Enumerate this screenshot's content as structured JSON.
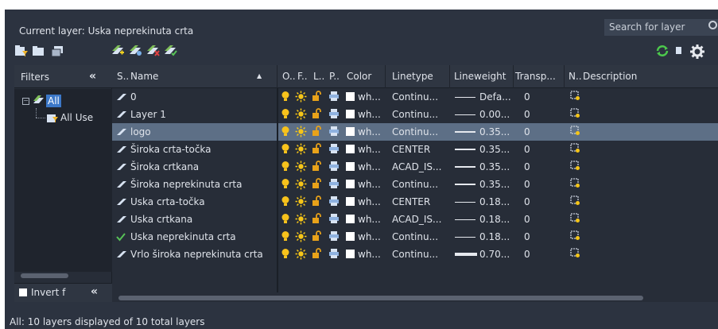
{
  "header": {
    "current_layer": "Current layer: Uska neprekinuta crta",
    "search_placeholder": "Search for layer"
  },
  "filters": {
    "title": "Filters",
    "tree": [
      {
        "label": "All",
        "selected": true
      },
      {
        "label": "All Use"
      }
    ],
    "invert_label": "Invert f"
  },
  "columns": [
    "S..",
    "Name",
    "O..",
    "F..",
    "L..",
    "P..",
    "Color",
    "Linetype",
    "Lineweight",
    "Transp...",
    "N..",
    "Description"
  ],
  "layers": [
    {
      "status": "layer",
      "name": "0",
      "color": "wh...",
      "linetype": "Continu...",
      "lineweight": "Defa...",
      "lw_style": "thin",
      "transparency": "0",
      "selected": false
    },
    {
      "status": "layer",
      "name": "Layer 1",
      "color": "wh...",
      "linetype": "Continu...",
      "lineweight": "0.00...",
      "lw_style": "thin",
      "transparency": "0",
      "selected": false
    },
    {
      "status": "layer",
      "name": "logo",
      "color": "wh...",
      "linetype": "Continu...",
      "lineweight": "0.35...",
      "lw_style": "medium",
      "transparency": "0",
      "selected": true
    },
    {
      "status": "layer",
      "name": "Široka crta-točka",
      "color": "wh...",
      "linetype": "CENTER",
      "lineweight": "0.35...",
      "lw_style": "medium",
      "transparency": "0",
      "selected": false
    },
    {
      "status": "layer",
      "name": "Široka crtkana",
      "color": "wh...",
      "linetype": "ACAD_IS...",
      "lineweight": "0.35...",
      "lw_style": "medium",
      "transparency": "0",
      "selected": false
    },
    {
      "status": "layer",
      "name": "Široka neprekinuta crta",
      "color": "wh...",
      "linetype": "Continu...",
      "lineweight": "0.35...",
      "lw_style": "medium",
      "transparency": "0",
      "selected": false
    },
    {
      "status": "layer",
      "name": "Uska crta-točka",
      "color": "wh...",
      "linetype": "CENTER",
      "lineweight": "0.18...",
      "lw_style": "thin",
      "transparency": "0",
      "selected": false
    },
    {
      "status": "layer",
      "name": "Uska crtkana",
      "color": "wh...",
      "linetype": "ACAD_IS...",
      "lineweight": "0.18...",
      "lw_style": "thin",
      "transparency": "0",
      "selected": false
    },
    {
      "status": "current",
      "name": "Uska neprekinuta crta",
      "color": "wh...",
      "linetype": "Continu...",
      "lineweight": "0.18...",
      "lw_style": "thin",
      "transparency": "0",
      "selected": false
    },
    {
      "status": "layer",
      "name": "Vrlo široka neprekinuta crta",
      "color": "wh...",
      "linetype": "Continu...",
      "lineweight": "0.70...",
      "lw_style": "thick",
      "transparency": "0",
      "selected": false
    }
  ],
  "status_bar": "All: 10 layers displayed of 10 total layers",
  "icons": {
    "on": "lightbulb-icon",
    "freeze": "sun-icon",
    "lock": "unlocked-padlock-icon",
    "plot": "printer-icon",
    "new_vp_freeze": "new-viewport-freeze-icon",
    "refresh": "refresh-icon",
    "settings": "gear-icon",
    "search": "search-icon"
  },
  "colors": {
    "bulb": "#f7c21c",
    "sun": "#f5c518",
    "lock": "#e8a21a",
    "plot": "#d8e3f2",
    "current_check": "#57c257",
    "selected_row": "#5d6f86",
    "refresh": "#4cc84c",
    "filter_highlight": "#3c78c8"
  }
}
